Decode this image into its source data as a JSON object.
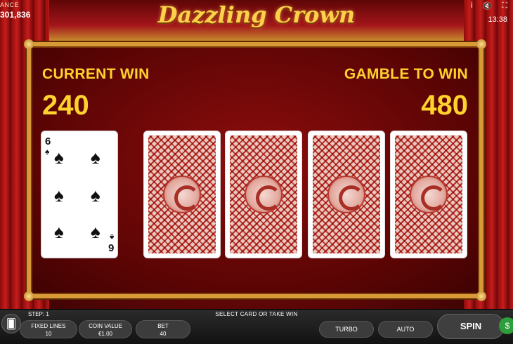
{
  "header": {
    "balance_label": "ANCE",
    "balance_value": "301,836",
    "logo_text": "Dazzling Crown",
    "time": "13:38",
    "icons": [
      "info-icon",
      "mute-icon",
      "fullscreen-icon"
    ],
    "info_glyph": "i",
    "mute_glyph": "🔇",
    "fullscreen_glyph": "⛶"
  },
  "gamble": {
    "current_win_label": "CURRENT WIN",
    "current_win_value": "240",
    "gamble_to_win_label": "GAMBLE TO WIN",
    "gamble_to_win_value": "480",
    "open_card": {
      "rank": "6",
      "suit": "♠"
    },
    "hidden_cards": 4
  },
  "bottom_bar": {
    "step_label": "STEP: 1",
    "status_message": "SELECT CARD OR TAKE WIN",
    "fixed_lines_label": "FIXED LINES",
    "fixed_lines_value": "10",
    "coin_value_label": "COIN VALUE",
    "coin_value_value": "€1.00",
    "bet_label": "BET",
    "bet_value": "40",
    "turbo_label": "TURBO",
    "auto_label": "AUTO",
    "spin_label": "SPIN",
    "cards_glyph": "🂠",
    "money_glyph": "$"
  },
  "colors": {
    "accent_gold": "#ffd22e",
    "panel_border": "#d79a37",
    "card_back_red": "#c03a34"
  }
}
